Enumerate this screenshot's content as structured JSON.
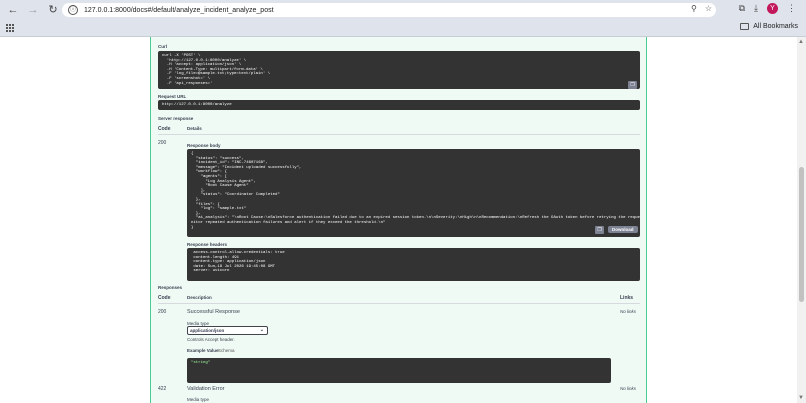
{
  "browser": {
    "url": "127.0.0.1:8000/docs#/default/analyze_incident_analyze_post",
    "all_bookmarks": "All Bookmarks",
    "avatar_letter": "Y"
  },
  "curl": {
    "label": "Curl",
    "lines": [
      "curl -X 'POST' \\",
      "  'http://127.0.0.1:8000/analyze' \\",
      "  -H 'accept: application/json' \\",
      "  -H 'Content-Type: multipart/form-data' \\",
      "  -F 'log_file=@sample.txt;type=text/plain' \\",
      "  -F 'screenshot=' \\",
      "  -F 'api_responses='"
    ]
  },
  "request_url": {
    "label": "Request URL",
    "value": "http://127.0.0.1:8000/analyze"
  },
  "server_response": {
    "label": "Server response",
    "col_code": "Code",
    "col_details": "Details",
    "code": "200",
    "body_label": "Response body",
    "body_lines": [
      "{",
      "  \"status\": \"success\",",
      "  \"incident_id\": \"INC-74607168\",",
      "  \"message\": \"Incident uploaded successfully\",",
      "  \"workflow\": {",
      "    \"agents\": [",
      "      \"Log Analysis Agent\",",
      "      \"Root Cause Agent\"",
      "    ],",
      "    \"status\": \"Coordinator Completed\"",
      "  },",
      "  \"files\": {",
      "    \"log\": \"sample.txt\"",
      "  },",
      "  \"ai_analysis\": \"\\nRoot Cause:\\nSalesforce authentication failed due to an expired session token.\\n\\nSeverity:\\nHigh\\n\\nRecommendation:\\nRefresh the OAuth token before retrying the request.\\nMo",
      "nitor repeated authentication failures and alert if they exceed the threshold.\\n\"",
      "}"
    ],
    "download_label": "Download",
    "headers_label": "Response headers",
    "header_lines": [
      " access-control-allow-credentials: true",
      " content-length: 491",
      " content-type: application/json",
      " date: Sun,19 Jul 2026 19:45:08 GMT",
      " server: uvicorn"
    ]
  },
  "responses": {
    "label": "Responses",
    "col_code": "Code",
    "col_description": "Description",
    "col_links": "Links",
    "items": [
      {
        "code": "200",
        "description": "Successful Response",
        "links": "No links",
        "media_type_label": "Media type",
        "media_type_value": "application/json",
        "controls_note": "Controls Accept header.",
        "example_tab": "Example Value",
        "schema_tab": "Schema",
        "example": "\"string\""
      },
      {
        "code": "422",
        "description": "Validation Error",
        "links": "No links",
        "media_type_label": "Media type"
      }
    ]
  }
}
